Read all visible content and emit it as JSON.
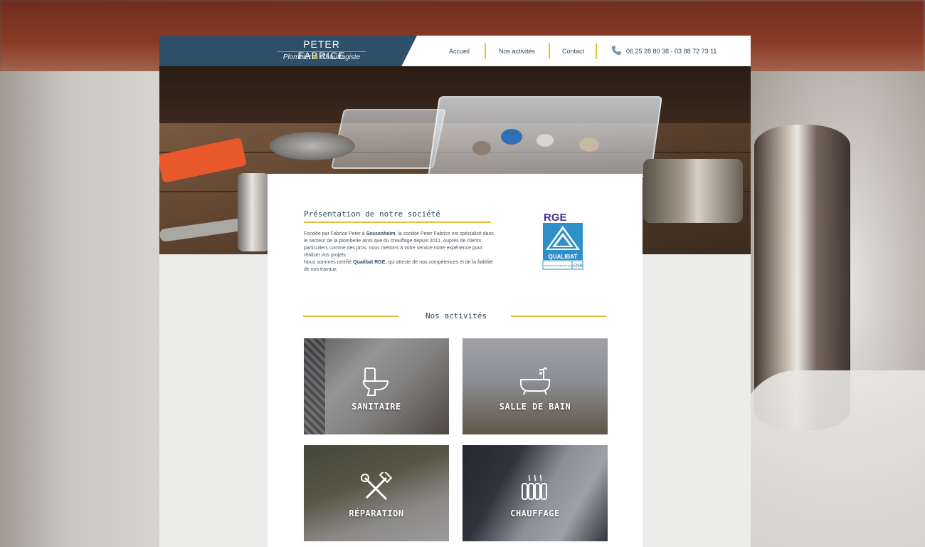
{
  "brand": {
    "name": "PETER FABRICE",
    "subtitle_part1": "Plombier ",
    "subtitle_amp": "&",
    "subtitle_part2": " Chauffagiste"
  },
  "nav": {
    "items": [
      {
        "label": "Accueil"
      },
      {
        "label": "Nos activités"
      },
      {
        "label": "Contact"
      }
    ],
    "phone_icon": "phone-icon",
    "phone": "06 25 28 80 38 - 03 88 72 73 11"
  },
  "intro": {
    "title": "Présentation de notre société",
    "p1_a": "Fondée par Fabrice Peter à ",
    "p1_city": "Sessenheim",
    "p1_b": ", la société Peter Fabrice est spécialisé dans le secteur de la plomberie ainsi que du chauffage depuis 2011.  Auprès de clients particuliers comme des pros, nous mettons à votre service notre expérience pour réaliser vos projets.",
    "p2_a": "Nous sommes certifié ",
    "p2_cert": "Qualibat RGE",
    "p2_b": ", qui atteste de nos compétences et de la fiabilité de nos travaux."
  },
  "certification": {
    "rge": "RGE",
    "qualibat": "QUALIBAT",
    "efficacite": "EFFICACITÉ ÉNERGÉTIQUE",
    "enr": "ENR"
  },
  "activities": {
    "title": "Nos activités",
    "tiles": [
      {
        "label": "SANITAIRE",
        "icon": "toilet-icon"
      },
      {
        "label": "SALLE DE BAIN",
        "icon": "bathtub-icon"
      },
      {
        "label": "RÉPARATION",
        "icon": "tools-icon"
      },
      {
        "label": "CHAUFFAGE",
        "icon": "radiator-icon"
      }
    ]
  },
  "colors": {
    "brand_blue": "#2d5068",
    "accent_yellow": "#e2c23a",
    "text_dark": "#2d4a60"
  }
}
